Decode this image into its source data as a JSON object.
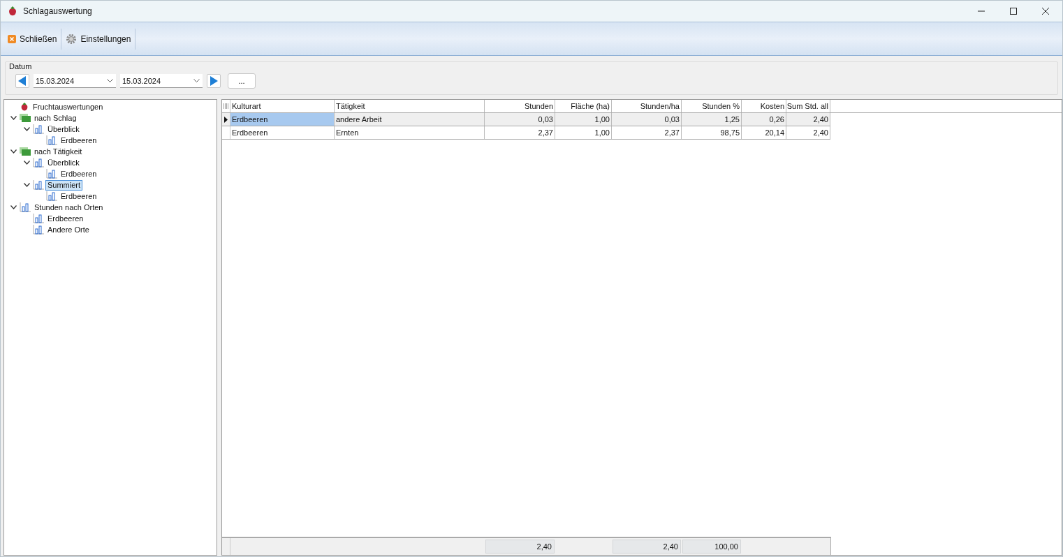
{
  "window": {
    "title": "Schlagauswertung"
  },
  "toolbar": [
    {
      "label": "Schließen",
      "kind": "close"
    },
    {
      "label": "Einstellungen",
      "kind": "gear"
    }
  ],
  "date_filter": {
    "label": "Datum",
    "from": "15.03.2024",
    "to": "15.03.2024",
    "more_button": "..."
  },
  "tree": [
    {
      "label": "Fruchtauswertungen",
      "kind": "strawberry",
      "selected": false
    },
    {
      "label": "nach Schlag",
      "kind": "folder",
      "expanded": true,
      "selected": false,
      "children": [
        {
          "label": "Überblick",
          "kind": "chart",
          "expanded": true,
          "selected": false,
          "children": [
            {
              "label": "Erdbeeren",
              "kind": "chart",
              "selected": false
            }
          ]
        }
      ]
    },
    {
      "label": "nach Tätigkeit",
      "kind": "folder",
      "expanded": true,
      "selected": false,
      "children": [
        {
          "label": "Überblick",
          "kind": "chart",
          "expanded": true,
          "selected": false,
          "children": [
            {
              "label": "Erdbeeren",
              "kind": "chart",
              "selected": false
            }
          ]
        },
        {
          "label": "Summiert",
          "kind": "chart",
          "expanded": true,
          "selected": true,
          "children": [
            {
              "label": "Erdbeeren",
              "kind": "chart",
              "selected": false
            }
          ]
        }
      ]
    },
    {
      "label": "Stunden nach Orten",
      "kind": "chart",
      "expanded": true,
      "selected": false,
      "children": [
        {
          "label": "Erdbeeren",
          "kind": "chart",
          "selected": false
        },
        {
          "label": "Andere Orte",
          "kind": "chart",
          "selected": false
        }
      ]
    }
  ],
  "table": {
    "columns": [
      {
        "label": "Kulturart",
        "kind": "text"
      },
      {
        "label": "Tätigkeit",
        "kind": "text"
      },
      {
        "label": "Stunden",
        "kind": "number",
        "total": "2,40"
      },
      {
        "label": "Fläche (ha)",
        "kind": "number"
      },
      {
        "label": "Stunden/ha",
        "kind": "number",
        "total": "2,40"
      },
      {
        "label": "Stunden %",
        "kind": "number",
        "total": "100,00"
      },
      {
        "label": "Kosten",
        "kind": "number"
      },
      {
        "label": "Sum Std. all",
        "kind": "number"
      }
    ],
    "rows": [
      {
        "selected": true,
        "cells": [
          "Erdbeeren",
          "andere Arbeit",
          "0,03",
          "1,00",
          "0,03",
          "1,25",
          "0,26",
          "2,40"
        ]
      },
      {
        "selected": false,
        "cells": [
          "Erdbeeren",
          "Ernten",
          "2,37",
          "1,00",
          "2,37",
          "98,75",
          "20,14",
          "2,40"
        ]
      }
    ]
  }
}
